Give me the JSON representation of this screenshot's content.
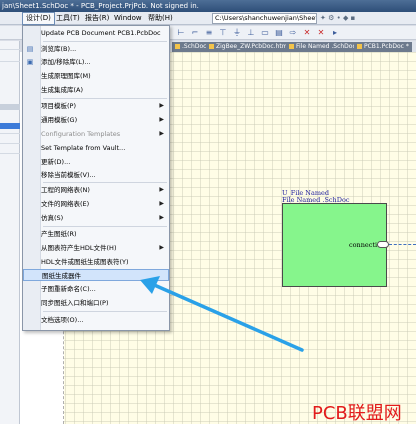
{
  "window": {
    "title": "jan\\Sheet1.SchDoc * - PCB_Project.PrjPcb. Not signed in."
  },
  "menubar": {
    "items": [
      "设计(D)",
      "工具(T)",
      "报告(R)",
      "Window",
      "帮助(H)"
    ],
    "path": "C:\\Users\\shanchuwenjian\\Sheet"
  },
  "toolbar": {
    "icons": [
      "align-icon",
      "wire-icon",
      "bus-icon",
      "net-label-icon",
      "power-icon",
      "gnd-icon",
      "part-icon",
      "sheet-symbol-icon",
      "port-icon",
      "no-erc-icon",
      "delete-icon"
    ],
    "right_icons": "✦ ⚙ • ◆ ▪"
  },
  "tabs": [
    ".SchDoc *",
    "ZigBee_ZW.PcbDoc.htm",
    "File Named .SchDoc *",
    "PCB1.PcbDoc *"
  ],
  "dropdown": {
    "items": [
      {
        "label": "Update PCB Document PCB1.PcbDoc",
        "icon": "",
        "submenu": false,
        "disabled": false,
        "highlight": false
      },
      {
        "label": "浏览库(B)...",
        "icon": "library-icon",
        "submenu": false,
        "disabled": false,
        "highlight": false
      },
      {
        "label": "添加/移除库(L)...",
        "icon": "add-remove-icon",
        "submenu": false,
        "disabled": false,
        "highlight": false
      },
      {
        "label": "生成原理图库(M)",
        "icon": "",
        "submenu": false,
        "disabled": false,
        "highlight": false
      },
      {
        "label": "生成集成库(A)",
        "icon": "",
        "submenu": false,
        "disabled": false,
        "highlight": false
      },
      {
        "label": "项目模板(P)",
        "icon": "",
        "submenu": true,
        "disabled": false,
        "highlight": false
      },
      {
        "label": "通用模板(G)",
        "icon": "",
        "submenu": true,
        "disabled": false,
        "highlight": false
      },
      {
        "label": "Configuration Templates",
        "icon": "",
        "submenu": true,
        "disabled": true,
        "highlight": false
      },
      {
        "label": "Set Template from Vault...",
        "icon": "",
        "submenu": false,
        "disabled": false,
        "highlight": false
      },
      {
        "label": "更新(D)...",
        "icon": "",
        "submenu": false,
        "disabled": false,
        "highlight": false
      },
      {
        "label": "移除当前模板(V)...",
        "icon": "",
        "submenu": false,
        "disabled": false,
        "highlight": false
      },
      {
        "label": "工程的网络表(N)",
        "icon": "",
        "submenu": true,
        "disabled": false,
        "highlight": false
      },
      {
        "label": "文件的网络表(E)",
        "icon": "",
        "submenu": true,
        "disabled": false,
        "highlight": false
      },
      {
        "label": "仿真(S)",
        "icon": "",
        "submenu": true,
        "disabled": false,
        "highlight": false
      },
      {
        "label": "产生图纸(R)",
        "icon": "",
        "submenu": false,
        "disabled": false,
        "highlight": false
      },
      {
        "label": "从图表符产生HDL文件(H)",
        "icon": "",
        "submenu": true,
        "disabled": false,
        "highlight": false
      },
      {
        "label": "HDL文件或图纸生成图表符(Y)",
        "icon": "",
        "submenu": false,
        "disabled": false,
        "highlight": false
      },
      {
        "label": "图纸生成器件",
        "icon": "",
        "submenu": false,
        "disabled": false,
        "highlight": true
      },
      {
        "label": "子图重新命名(C)...",
        "icon": "",
        "submenu": false,
        "disabled": false,
        "highlight": false
      },
      {
        "label": "同步图纸入口和端口(P)",
        "icon": "",
        "submenu": false,
        "disabled": false,
        "highlight": false
      },
      {
        "label": "文档选项(O)...",
        "icon": "",
        "submenu": false,
        "disabled": false,
        "highlight": false
      }
    ]
  },
  "sheet_symbol": {
    "designator": "U_File Named",
    "filename": "File Named .SchDoc",
    "port": "connection",
    "fill_color": "#86f58c"
  },
  "annotation": {
    "arrow_color": "#2aa1e8"
  },
  "watermark": "PCB联盟网"
}
